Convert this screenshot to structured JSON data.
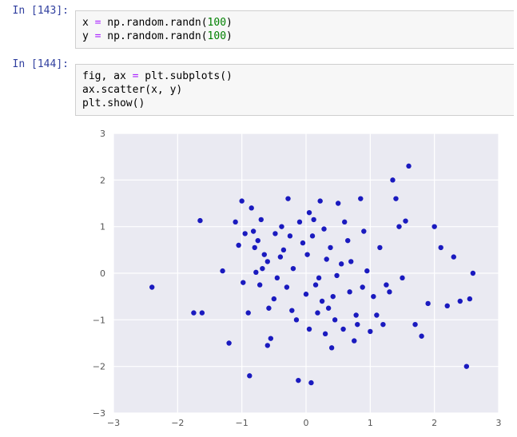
{
  "cells": [
    {
      "prompt": "In [143]:",
      "code_tokens": [
        [
          [
            "x ",
            ""
          ],
          [
            "=",
            "op"
          ],
          [
            " np.random.randn(",
            ""
          ],
          [
            "100",
            "num"
          ],
          [
            ")",
            ""
          ]
        ],
        [
          [
            "y ",
            ""
          ],
          [
            "=",
            "op"
          ],
          [
            " np.random.randn(",
            ""
          ],
          [
            "100",
            "num"
          ],
          [
            ")",
            ""
          ]
        ]
      ]
    },
    {
      "prompt": "In [144]:",
      "code_tokens": [
        [
          [
            "fig, ax ",
            ""
          ],
          [
            "=",
            "op"
          ],
          [
            " plt.subplots()",
            ""
          ]
        ],
        [
          [
            "ax.scatter(x, y)",
            ""
          ]
        ],
        [
          [
            "plt.show()",
            ""
          ]
        ]
      ]
    }
  ],
  "chart_data": {
    "type": "scatter",
    "xlabel": "",
    "ylabel": "",
    "xlim": [
      -3,
      3
    ],
    "ylim": [
      -3,
      3
    ],
    "xticks": [
      -3,
      -2,
      -1,
      0,
      1,
      2,
      3
    ],
    "yticks": [
      -3,
      -2,
      -1,
      0,
      1,
      2,
      3
    ],
    "x": [
      -2.4,
      -1.75,
      -1.65,
      -1.62,
      -1.3,
      -1.2,
      -1.1,
      -1.05,
      -1.0,
      -0.98,
      -0.95,
      -0.9,
      -0.88,
      -0.85,
      -0.82,
      -0.8,
      -0.78,
      -0.75,
      -0.72,
      -0.7,
      -0.68,
      -0.65,
      -0.6,
      -0.58,
      -0.55,
      -0.5,
      -0.48,
      -0.45,
      -0.4,
      -0.38,
      -0.35,
      -0.3,
      -0.28,
      -0.25,
      -0.22,
      -0.2,
      -0.15,
      -0.12,
      -0.1,
      -0.05,
      0.0,
      0.02,
      0.05,
      0.08,
      0.1,
      0.12,
      0.15,
      0.18,
      0.2,
      0.22,
      0.25,
      0.28,
      0.3,
      0.32,
      0.35,
      0.38,
      0.4,
      0.42,
      0.45,
      0.48,
      0.5,
      0.55,
      0.58,
      0.6,
      0.65,
      0.68,
      0.7,
      0.75,
      0.78,
      0.8,
      0.85,
      0.88,
      0.9,
      0.95,
      1.0,
      1.05,
      1.1,
      1.15,
      1.2,
      1.25,
      1.3,
      1.35,
      1.4,
      1.45,
      1.5,
      1.55,
      1.6,
      1.7,
      1.8,
      1.9,
      2.0,
      2.1,
      2.2,
      2.3,
      2.4,
      2.5,
      2.55,
      2.6,
      -0.6,
      0.05
    ],
    "y": [
      -0.3,
      -0.85,
      1.13,
      -0.85,
      0.05,
      -1.5,
      1.1,
      0.6,
      1.55,
      -0.2,
      0.85,
      -0.85,
      -2.2,
      1.4,
      0.9,
      0.55,
      0.02,
      0.7,
      -0.25,
      1.15,
      0.1,
      0.4,
      0.25,
      -0.75,
      -1.4,
      -0.55,
      0.85,
      -0.1,
      0.35,
      1.0,
      0.5,
      -0.3,
      1.6,
      0.8,
      -0.8,
      0.1,
      -1.0,
      -2.3,
      1.1,
      0.65,
      -0.45,
      0.4,
      -1.2,
      -2.35,
      0.8,
      1.15,
      -0.25,
      -0.85,
      -0.1,
      1.55,
      -0.6,
      0.95,
      -1.3,
      0.3,
      -0.75,
      0.55,
      -1.6,
      -0.5,
      -1.0,
      -0.05,
      1.5,
      0.2,
      -1.2,
      1.1,
      0.7,
      -0.4,
      0.25,
      -1.45,
      -0.9,
      -1.1,
      1.6,
      -0.3,
      0.9,
      0.05,
      -1.25,
      -0.5,
      -0.9,
      0.55,
      -1.1,
      -0.25,
      -0.4,
      2.0,
      1.6,
      1.0,
      -0.1,
      1.12,
      2.3,
      -1.1,
      -1.35,
      -0.65,
      1.0,
      0.55,
      -0.7,
      0.35,
      -0.6,
      -2.0,
      -0.55,
      0.0,
      -1.55,
      1.3
    ]
  }
}
